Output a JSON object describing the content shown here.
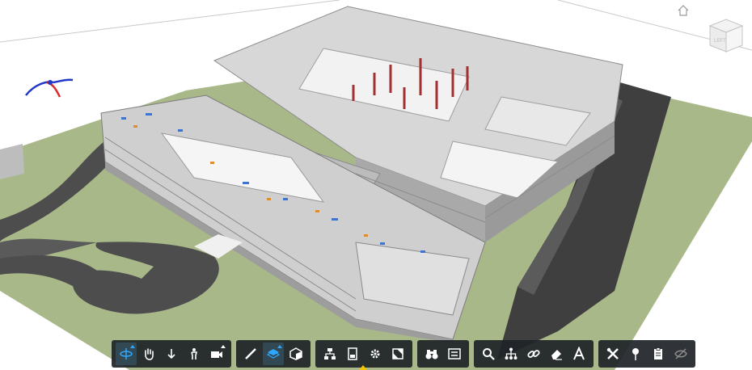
{
  "viewcube": {
    "label": "LEFT"
  },
  "toolbar": {
    "groups": [
      {
        "name": "navigation",
        "tools": [
          "orbit-icon",
          "pan-icon",
          "zoom-icon",
          "first-person-icon",
          "camera-icon"
        ]
      },
      {
        "name": "measure-section",
        "tools": [
          "measure-icon",
          "section-icon",
          "explode-icon"
        ]
      },
      {
        "name": "model",
        "tools": [
          "model-browser-icon",
          "properties-icon",
          "settings-icon",
          "fullscreen-icon"
        ]
      },
      {
        "name": "review",
        "tools": [
          "binoculars-icon",
          "list-icon"
        ]
      },
      {
        "name": "markup",
        "tools": [
          "search-icon",
          "hierarchy-icon",
          "link-icon",
          "eraser-icon",
          "text-icon"
        ]
      },
      {
        "name": "utilities",
        "tools": [
          "tools-icon",
          "pin-icon",
          "clipboard-icon",
          "hide-icon"
        ]
      }
    ],
    "active_tools": [
      "orbit-icon",
      "section-icon"
    ]
  },
  "colors": {
    "toolbar_bg": "#1e2226",
    "toolbar_icon": "#ffffff",
    "active_accent": "#2ea8ff",
    "grass": "#a9b889",
    "road": "#4a4a4a",
    "building": "#c8c8c8"
  }
}
